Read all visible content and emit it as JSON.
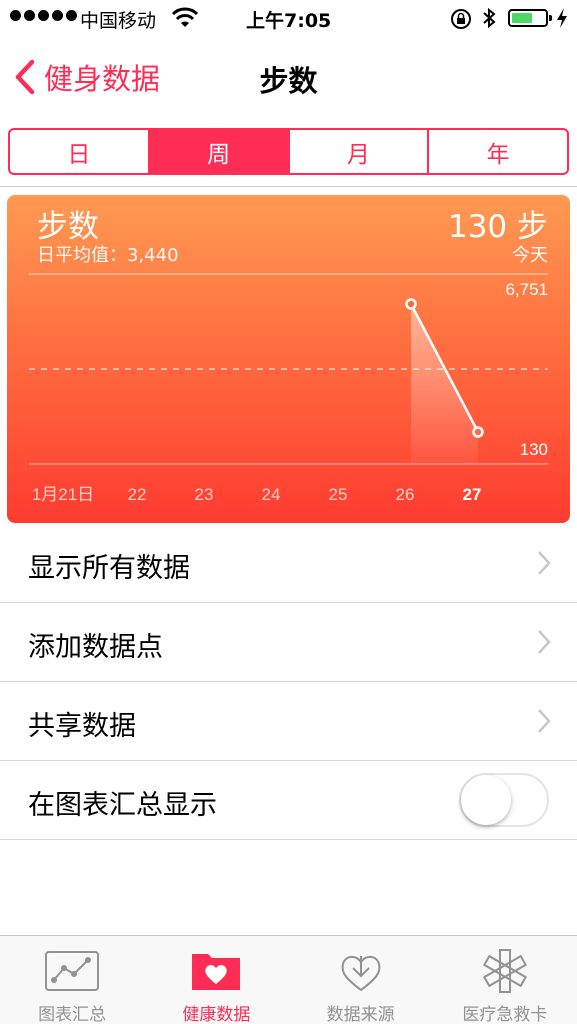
{
  "status_bar": {
    "carrier": "中国移动",
    "time": "上午7:05"
  },
  "nav": {
    "back_label": "健身数据",
    "title": "步数"
  },
  "segments": [
    "日",
    "周",
    "月",
    "年"
  ],
  "selected_segment": "周",
  "card": {
    "title": "步数",
    "avg_label": "日平均值：3,440",
    "today_value": "130 步",
    "today_label": "今天",
    "max_label": "6,751",
    "min_label": "130"
  },
  "chart_data": {
    "type": "line",
    "x": [
      "1月21日",
      "22",
      "23",
      "24",
      "25",
      "26",
      "27"
    ],
    "points": [
      {
        "x": "26",
        "y": 6751
      },
      {
        "x": "27",
        "y": 130
      }
    ],
    "ylim": [
      0,
      6751
    ],
    "grid": true
  },
  "list": {
    "items": [
      "显示所有数据",
      "添加数据点",
      "共享数据"
    ],
    "toggle_label": "在图表汇总显示",
    "toggle_on": false
  },
  "tabbar": {
    "items": [
      "图表汇总",
      "健康数据",
      "数据来源",
      "医疗急救卡"
    ],
    "active": "健康数据"
  },
  "colors": {
    "accent": "#ff2d55",
    "card_top": "#ff9a52",
    "card_bottom": "#ff3b30",
    "battery": "#4cd964"
  }
}
